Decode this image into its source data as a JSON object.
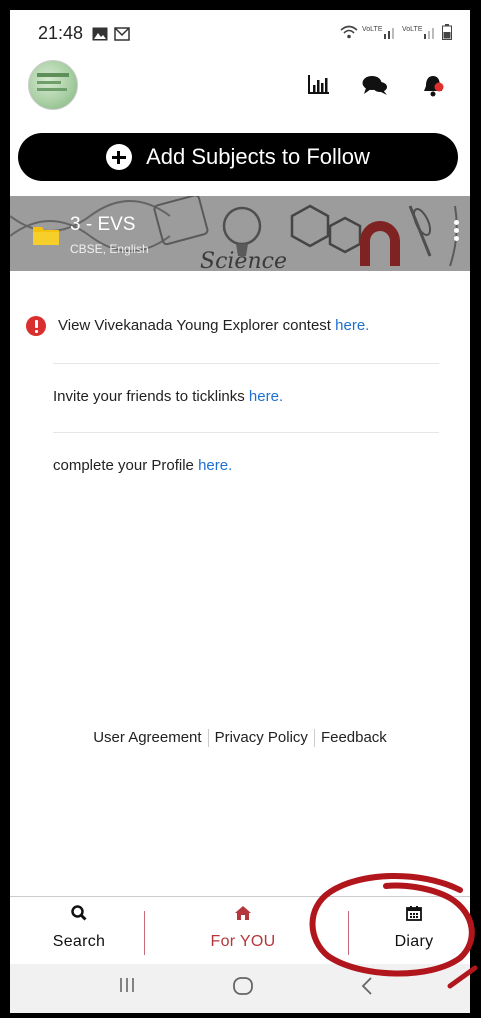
{
  "status_bar": {
    "time": "21:48",
    "icons": [
      "gallery-icon",
      "mail-icon",
      "wifi-icon",
      "volte-lte1-icon",
      "volte-lte2-icon",
      "battery-icon"
    ]
  },
  "header": {
    "icons": [
      "bar-chart-icon",
      "chat-icon",
      "bell-icon"
    ]
  },
  "add_subjects": {
    "label": "Add Subjects to Follow"
  },
  "subject": {
    "title": "3 - EVS",
    "subtitle": "CBSE, English"
  },
  "notes": [
    {
      "text": "View Vivekanada Young Explorer contest ",
      "link": "here."
    },
    {
      "text": "Invite your friends to ticklinks ",
      "link": "here."
    },
    {
      "text": "complete your Profile ",
      "link": "here."
    }
  ],
  "footer_links": [
    "User Agreement",
    "Privacy Policy",
    "Feedback"
  ],
  "bottom_nav": [
    {
      "label": "Search",
      "icon": "search-icon"
    },
    {
      "label": "For YOU",
      "icon": "home-icon"
    },
    {
      "label": "Diary",
      "icon": "calendar-icon"
    }
  ],
  "system_nav": [
    "recents-icon",
    "home-circle-icon",
    "back-icon"
  ],
  "colors": {
    "accent": "#b5363b",
    "link": "#1e6fd0",
    "alert": "#d9302f",
    "annotation": "#b0161c"
  }
}
